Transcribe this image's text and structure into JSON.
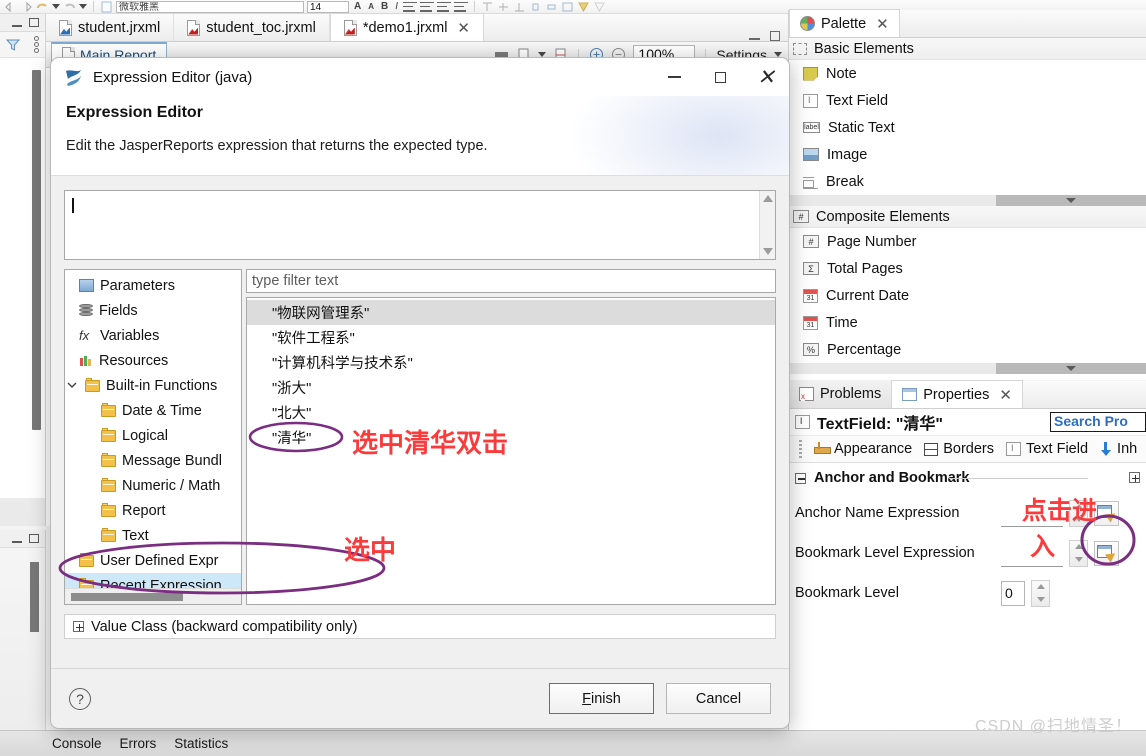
{
  "ide": {
    "font_selector_value": "微软雅黑",
    "font_size_value": "14",
    "bold_label": "B",
    "italic_label": "I",
    "editor_tabs": [
      {
        "label": "student.jrxml",
        "icon": "jrxml-file-icon",
        "active": false,
        "closable": false
      },
      {
        "label": "student_toc.jrxml",
        "icon": "jrxml-file-icon",
        "active": false,
        "closable": false
      },
      {
        "label": "*demo1.jrxml",
        "icon": "jrxml-file-icon",
        "active": true,
        "closable": true
      }
    ],
    "report_tab_label": "Main Report",
    "zoom_value": "100%",
    "settings_label": "Settings",
    "status_tabs": [
      "Console",
      "Errors",
      "Statistics"
    ],
    "watermark": "CSDN @扫地情圣！"
  },
  "palette": {
    "tab_label": "Palette",
    "groups": [
      {
        "title": "Basic Elements",
        "icon": "dashed-box-icon",
        "items": [
          {
            "label": "Note",
            "icon": "note-icon"
          },
          {
            "label": "Text Field",
            "icon": "text-field-icon"
          },
          {
            "label": "Static Text",
            "icon": "label-icon"
          },
          {
            "label": "Image",
            "icon": "image-icon"
          },
          {
            "label": "Break",
            "icon": "break-icon"
          }
        ]
      },
      {
        "title": "Composite Elements",
        "icon": "hash-box-icon",
        "items": [
          {
            "label": "Page Number",
            "icon": "hash-icon"
          },
          {
            "label": "Total Pages",
            "icon": "sigma-icon"
          },
          {
            "label": "Current Date",
            "icon": "calendar-icon"
          },
          {
            "label": "Time",
            "icon": "calendar-icon"
          },
          {
            "label": "Percentage",
            "icon": "percent-icon"
          }
        ]
      }
    ]
  },
  "properties": {
    "tabs": [
      {
        "label": "Problems",
        "icon": "problems-icon",
        "active": false
      },
      {
        "label": "Properties",
        "icon": "properties-grid-icon",
        "active": true,
        "closable": true
      }
    ],
    "object_title": "TextField: \"清华\"",
    "search_placeholder": "Search Pro",
    "sub_tabs": [
      {
        "label": "Appearance",
        "icon": "ruler-icon"
      },
      {
        "label": "Borders",
        "icon": "borders-icon"
      },
      {
        "label": "Text Field",
        "icon": "text-field-icon"
      },
      {
        "label": "Inh",
        "icon": "inherit-arrow-icon"
      }
    ],
    "section_title": "Anchor and Bookmark",
    "rows": [
      {
        "label": "Anchor Name Expression",
        "value": "",
        "control": "expression-with-editor"
      },
      {
        "label": "Bookmark Level Expression",
        "value": "",
        "control": "expression-with-editor"
      },
      {
        "label": "Bookmark Level",
        "value": "0",
        "control": "number-spinner"
      }
    ]
  },
  "dialog": {
    "window_title": "Expression Editor (java)",
    "heading": "Expression Editor",
    "subheading": "Edit the JasperReports expression that returns the expected type.",
    "expression_value": "",
    "filter_placeholder": "type filter text",
    "tree": [
      {
        "label": "Parameters",
        "icon": "parameters-icon",
        "level": 1,
        "selected": false,
        "twisty": ""
      },
      {
        "label": "Fields",
        "icon": "database-icon",
        "level": 1,
        "selected": false,
        "twisty": ""
      },
      {
        "label": "Variables",
        "icon": "fx-icon",
        "level": 1,
        "selected": false,
        "twisty": ""
      },
      {
        "label": "Resources",
        "icon": "resources-icon",
        "level": 1,
        "selected": false,
        "twisty": ""
      },
      {
        "label": "Built-in Functions",
        "icon": "folder-icon",
        "level": 1,
        "selected": false,
        "twisty": "v"
      },
      {
        "label": "Date & Time",
        "icon": "folder-icon",
        "level": 2,
        "selected": false,
        "twisty": ""
      },
      {
        "label": "Logical",
        "icon": "folder-icon",
        "level": 2,
        "selected": false,
        "twisty": ""
      },
      {
        "label": "Message Bundl",
        "icon": "folder-icon",
        "level": 2,
        "selected": false,
        "twisty": ""
      },
      {
        "label": "Numeric / Math",
        "icon": "folder-icon",
        "level": 2,
        "selected": false,
        "twisty": ""
      },
      {
        "label": "Report",
        "icon": "folder-icon",
        "level": 2,
        "selected": false,
        "twisty": ""
      },
      {
        "label": "Text",
        "icon": "folder-icon",
        "level": 2,
        "selected": false,
        "twisty": ""
      },
      {
        "label": "User Defined Expr",
        "icon": "folder-icon",
        "level": 1,
        "selected": false,
        "twisty": ""
      },
      {
        "label": "Recent Expression",
        "icon": "folder-icon",
        "level": 1,
        "selected": true,
        "twisty": ""
      }
    ],
    "expressions": [
      {
        "label": "\"物联网管理系\"",
        "selected": true
      },
      {
        "label": "\"软件工程系\"",
        "selected": false
      },
      {
        "label": "\"计算机科学与技术系\"",
        "selected": false
      },
      {
        "label": "\"浙大\"",
        "selected": false
      },
      {
        "label": "\"北大\"",
        "selected": false
      },
      {
        "label": "\"清华\"",
        "selected": false
      }
    ],
    "value_class_label": "Value Class (backward compatibility only)",
    "help_label": "?",
    "finish_label": "Finish",
    "finish_mnemonic": "F",
    "finish_rest": "inish",
    "cancel_label": "Cancel"
  },
  "annotations": {
    "note_select_double_click": "选中清华双击",
    "note_select": "选中",
    "note_click_line1": "点击进",
    "note_click_line2": "入",
    "colors": {
      "red": "#fb3b3b",
      "purple": "#7b2d82"
    }
  }
}
